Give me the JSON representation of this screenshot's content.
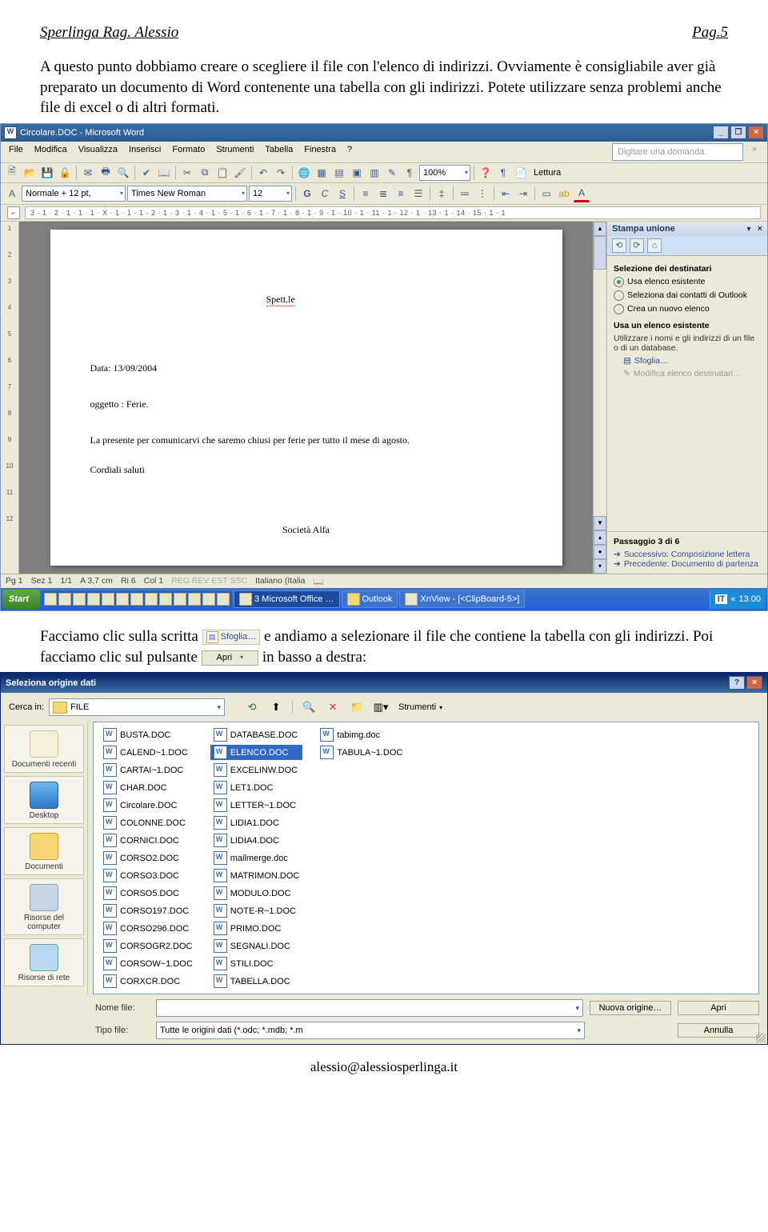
{
  "header": {
    "left": "Sperlinga Rag. Alessio",
    "right": "Pag.5"
  },
  "para1": "A questo punto dobbiamo creare o scegliere il file con l'elenco di indirizzi. Ovviamente è consigliabile aver già preparato un documento di Word contenente una tabella con gli indirizzi. Potete utilizzare senza problemi anche file di excel o di altri formati.",
  "word": {
    "title": "Circolare.DOC - Microsoft Word",
    "menu": [
      "File",
      "Modifica",
      "Visualizza",
      "Inserisci",
      "Formato",
      "Strumenti",
      "Tabella",
      "Finestra",
      "?"
    ],
    "searchHint": "Digitare una domanda.",
    "styleCombo": "Normale + 12 pt,",
    "fontCombo": "Times New Roman",
    "sizeCombo": "12",
    "zoom": "100%",
    "readBtn": "Lettura",
    "ruler": "3 · 1 · 2 · 1 · 1 · 1 · X · 1 · 1 · 1 · 2 · 1 · 3 · 1 · 4 · 1 · 5 · 1 · 6 · 1 · 7 · 1 · 8 · 1 · 9 · 1 · 10 · 1 · 11 · 1 · 12 · 1 · 13 · 1 · 14 · 15 · 1 · 1",
    "doc": {
      "spett": "Spett.le",
      "date": "Data:  13/09/2004",
      "subject": "oggetto : Ferie.",
      "body": "La presente per comunicarvi che saremo chiusi per ferie per tutto il mese di agosto.",
      "closing": "Cordiali saluti",
      "company": "Società Alfa"
    },
    "pane": {
      "title": "Stampa unione",
      "section1": "Selezione dei destinatari",
      "opt1": "Usa elenco esistente",
      "opt2": "Seleziona dai contatti di Outlook",
      "opt3": "Crea un nuovo elenco",
      "section2": "Usa un elenco esistente",
      "hint": "Utilizzare i nomi e gli indirizzi di un file o di un database.",
      "browse": "Sfoglia…",
      "edit": "Modifica elenco destinatari…",
      "step": "Passaggio 3 di 6",
      "next": "Successivo: Composizione lettera",
      "prev": "Precedente: Documento di partenza"
    },
    "status": {
      "pg": "Pg 1",
      "sez": "Sez 1",
      "pages": "1/1",
      "at": "A 3,7 cm",
      "ri": "Ri 6",
      "col": "Col 1",
      "flags": "REG  REV  EST  SSC",
      "lang": "Italiano (Italia"
    },
    "taskbar": {
      "start": "Start",
      "office": "3 Microsoft Office …",
      "outlook": "Outlook",
      "xnview": "XnView - [<ClipBoard-5>]",
      "lang": "IT",
      "time": "13.00"
    }
  },
  "para2_a": "Facciamo clic sulla scritta ",
  "para2_b": " e andiamo a selezionare il file che contiene la tabella con gli indirizzi. Poi facciamo clic sul pulsante ",
  "para2_c": " in basso a destra:",
  "sfoglia": "Sfoglia…",
  "apri": "Apri",
  "dlg": {
    "title": "Seleziona origine dati",
    "lookLabel": "Cerca in:",
    "lookValue": "FILE",
    "tools": "Strumenti",
    "places": [
      "Documenti recenti",
      "Desktop",
      "Documenti",
      "Risorse del computer",
      "Risorse di rete"
    ],
    "col1": [
      "BUSTA.DOC",
      "CALEND~1.DOC",
      "CARTAI~1.DOC",
      "CHAR.DOC",
      "Circolare.DOC",
      "COLONNE.DOC",
      "CORNICI.DOC",
      "CORSO2.DOC",
      "CORSO3.DOC",
      "CORSO5.DOC",
      "CORSO197.DOC",
      "CORSO296.DOC",
      "CORSOGR2.DOC",
      "CORSOW~1.DOC",
      "CORXCR.DOC"
    ],
    "col2": [
      "DATABASE.DOC",
      "ELENCO.DOC",
      "EXCELINW.DOC",
      "LET1.DOC",
      "LETTER~1.DOC",
      "LIDIA1.DOC",
      "LIDIA4.DOC",
      "mailmerge.doc",
      "MATRIMON.DOC",
      "MODULO.DOC",
      "NOTE-R~1.DOC",
      "PRIMO.DOC",
      "SEGNALI.DOC",
      "STILI.DOC",
      "TABELLA.DOC"
    ],
    "col3": [
      "tabimg.doc",
      "TABULA~1.DOC"
    ],
    "selected": "ELENCO.DOC",
    "fileLbl": "Nome file:",
    "typeLbl": "Tipo file:",
    "typeVal": "Tutte le origini dati (*.odc; *.mdb; *.m",
    "newSrc": "Nuova origine…",
    "open": "Apri",
    "cancel": "Annulla"
  },
  "footer": "alessio@alessiosperlinga.it"
}
